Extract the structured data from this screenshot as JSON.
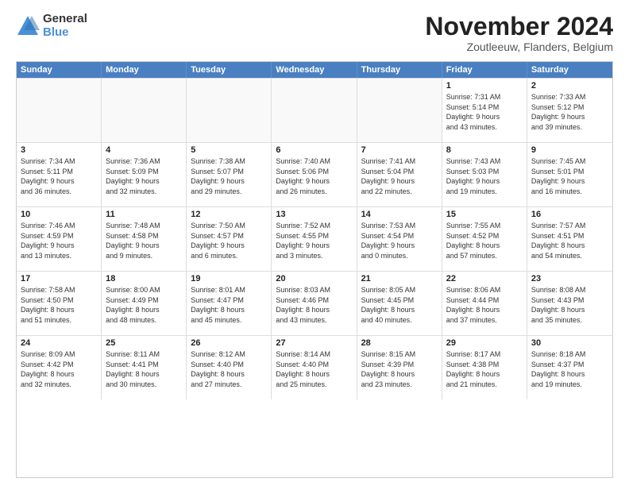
{
  "logo": {
    "general": "General",
    "blue": "Blue"
  },
  "title": "November 2024",
  "location": "Zoutleeuw, Flanders, Belgium",
  "header_days": [
    "Sunday",
    "Monday",
    "Tuesday",
    "Wednesday",
    "Thursday",
    "Friday",
    "Saturday"
  ],
  "weeks": [
    [
      {
        "day": "",
        "info": ""
      },
      {
        "day": "",
        "info": ""
      },
      {
        "day": "",
        "info": ""
      },
      {
        "day": "",
        "info": ""
      },
      {
        "day": "",
        "info": ""
      },
      {
        "day": "1",
        "info": "Sunrise: 7:31 AM\nSunset: 5:14 PM\nDaylight: 9 hours\nand 43 minutes."
      },
      {
        "day": "2",
        "info": "Sunrise: 7:33 AM\nSunset: 5:12 PM\nDaylight: 9 hours\nand 39 minutes."
      }
    ],
    [
      {
        "day": "3",
        "info": "Sunrise: 7:34 AM\nSunset: 5:11 PM\nDaylight: 9 hours\nand 36 minutes."
      },
      {
        "day": "4",
        "info": "Sunrise: 7:36 AM\nSunset: 5:09 PM\nDaylight: 9 hours\nand 32 minutes."
      },
      {
        "day": "5",
        "info": "Sunrise: 7:38 AM\nSunset: 5:07 PM\nDaylight: 9 hours\nand 29 minutes."
      },
      {
        "day": "6",
        "info": "Sunrise: 7:40 AM\nSunset: 5:06 PM\nDaylight: 9 hours\nand 26 minutes."
      },
      {
        "day": "7",
        "info": "Sunrise: 7:41 AM\nSunset: 5:04 PM\nDaylight: 9 hours\nand 22 minutes."
      },
      {
        "day": "8",
        "info": "Sunrise: 7:43 AM\nSunset: 5:03 PM\nDaylight: 9 hours\nand 19 minutes."
      },
      {
        "day": "9",
        "info": "Sunrise: 7:45 AM\nSunset: 5:01 PM\nDaylight: 9 hours\nand 16 minutes."
      }
    ],
    [
      {
        "day": "10",
        "info": "Sunrise: 7:46 AM\nSunset: 4:59 PM\nDaylight: 9 hours\nand 13 minutes."
      },
      {
        "day": "11",
        "info": "Sunrise: 7:48 AM\nSunset: 4:58 PM\nDaylight: 9 hours\nand 9 minutes."
      },
      {
        "day": "12",
        "info": "Sunrise: 7:50 AM\nSunset: 4:57 PM\nDaylight: 9 hours\nand 6 minutes."
      },
      {
        "day": "13",
        "info": "Sunrise: 7:52 AM\nSunset: 4:55 PM\nDaylight: 9 hours\nand 3 minutes."
      },
      {
        "day": "14",
        "info": "Sunrise: 7:53 AM\nSunset: 4:54 PM\nDaylight: 9 hours\nand 0 minutes."
      },
      {
        "day": "15",
        "info": "Sunrise: 7:55 AM\nSunset: 4:52 PM\nDaylight: 8 hours\nand 57 minutes."
      },
      {
        "day": "16",
        "info": "Sunrise: 7:57 AM\nSunset: 4:51 PM\nDaylight: 8 hours\nand 54 minutes."
      }
    ],
    [
      {
        "day": "17",
        "info": "Sunrise: 7:58 AM\nSunset: 4:50 PM\nDaylight: 8 hours\nand 51 minutes."
      },
      {
        "day": "18",
        "info": "Sunrise: 8:00 AM\nSunset: 4:49 PM\nDaylight: 8 hours\nand 48 minutes."
      },
      {
        "day": "19",
        "info": "Sunrise: 8:01 AM\nSunset: 4:47 PM\nDaylight: 8 hours\nand 45 minutes."
      },
      {
        "day": "20",
        "info": "Sunrise: 8:03 AM\nSunset: 4:46 PM\nDaylight: 8 hours\nand 43 minutes."
      },
      {
        "day": "21",
        "info": "Sunrise: 8:05 AM\nSunset: 4:45 PM\nDaylight: 8 hours\nand 40 minutes."
      },
      {
        "day": "22",
        "info": "Sunrise: 8:06 AM\nSunset: 4:44 PM\nDaylight: 8 hours\nand 37 minutes."
      },
      {
        "day": "23",
        "info": "Sunrise: 8:08 AM\nSunset: 4:43 PM\nDaylight: 8 hours\nand 35 minutes."
      }
    ],
    [
      {
        "day": "24",
        "info": "Sunrise: 8:09 AM\nSunset: 4:42 PM\nDaylight: 8 hours\nand 32 minutes."
      },
      {
        "day": "25",
        "info": "Sunrise: 8:11 AM\nSunset: 4:41 PM\nDaylight: 8 hours\nand 30 minutes."
      },
      {
        "day": "26",
        "info": "Sunrise: 8:12 AM\nSunset: 4:40 PM\nDaylight: 8 hours\nand 27 minutes."
      },
      {
        "day": "27",
        "info": "Sunrise: 8:14 AM\nSunset: 4:40 PM\nDaylight: 8 hours\nand 25 minutes."
      },
      {
        "day": "28",
        "info": "Sunrise: 8:15 AM\nSunset: 4:39 PM\nDaylight: 8 hours\nand 23 minutes."
      },
      {
        "day": "29",
        "info": "Sunrise: 8:17 AM\nSunset: 4:38 PM\nDaylight: 8 hours\nand 21 minutes."
      },
      {
        "day": "30",
        "info": "Sunrise: 8:18 AM\nSunset: 4:37 PM\nDaylight: 8 hours\nand 19 minutes."
      }
    ]
  ]
}
